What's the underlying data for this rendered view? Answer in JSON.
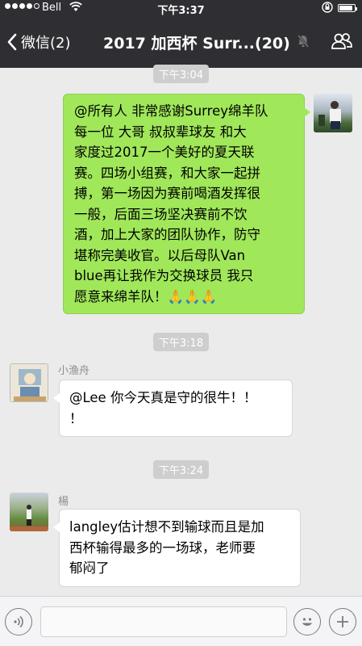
{
  "status": {
    "carrier": "Bell",
    "time": "下午3:37",
    "battery_level": 0.9,
    "signal_dots": 4
  },
  "nav": {
    "back_label": "微信(2)",
    "title": "2017 加西杯 Surr...(20)",
    "icons": [
      "chevron-left-icon",
      "mute-bell-icon",
      "group-members-icon"
    ]
  },
  "messages": [
    {
      "type": "timestamp",
      "text": "下午3:04"
    },
    {
      "type": "outgoing",
      "lines": [
        "@所有人 非常感谢Surrey绵羊队",
        "每一位 大哥 叔叔辈球友 和大",
        "家度过2017一个美好的夏天联",
        "赛。四场小组赛，和大家一起拼",
        "搏，第一场因为赛前喝酒发挥很",
        "一般，后面三场坚决赛前不饮",
        "酒，加上大家的团队协作，防守",
        "堪称完美收官。以后母队Van",
        "blue再让我作为交换球员 我只",
        "愿意来绵羊队！🙏🙏🙏"
      ]
    },
    {
      "type": "timestamp",
      "text": "下午3:18"
    },
    {
      "type": "incoming",
      "name": "小渔舟",
      "lines": [
        "@Lee 你今天真是守的很牛！！",
        "！"
      ]
    },
    {
      "type": "timestamp",
      "text": "下午3:24"
    },
    {
      "type": "incoming",
      "name": "楊",
      "lines": [
        "langley估计想不到输球而且是加",
        "西杯输得最多的一场球，老师要",
        "郁闷了"
      ]
    }
  ],
  "input": {
    "placeholder": "",
    "icons": [
      "voice-icon",
      "emoji-icon",
      "plus-icon"
    ]
  }
}
